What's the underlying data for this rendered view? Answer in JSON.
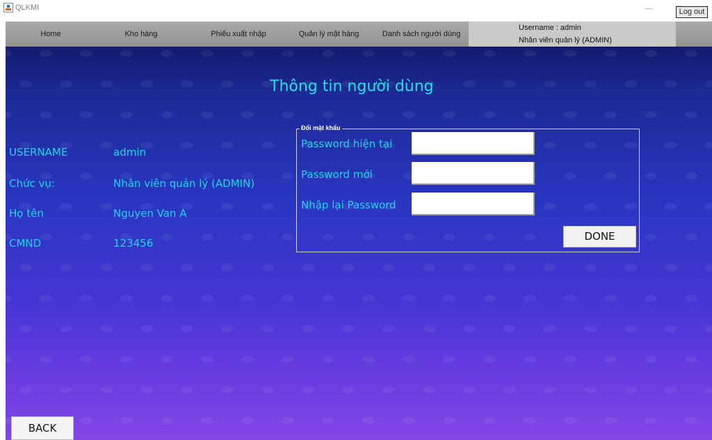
{
  "window": {
    "title": "QLKMI",
    "icon": "java-app-icon",
    "controls": {
      "minimize": "—",
      "close": "✕"
    }
  },
  "menu": {
    "home": "Home",
    "kho_hang": "Kho hàng",
    "phieu_xuat_nhap": "Phiếu xuất nhập",
    "quan_ly_mat_hang": "Quản lý mặt hàng",
    "danh_sach_nguoi_dung": "Danh sách người dùng"
  },
  "user_panel": {
    "username_line": "Username : admin",
    "role_line": "Nhân viên quản lý (ADMIN)",
    "logout_label": "Log out"
  },
  "page": {
    "title": "Thông tin người dùng"
  },
  "user_info": {
    "username_label": "USERNAME",
    "username_value": "admin",
    "chucvu_label": "Chức vụ:",
    "chucvu_value": "Nhân viên quản lý (ADMIN)",
    "hoten_label": "Họ tên",
    "hoten_value": "Nguyen Van A",
    "cmnd_label": "CMND",
    "cmnd_value": "123456"
  },
  "change_password": {
    "legend": "Đổi mật khẩu",
    "current_label": "Password hiện tại",
    "current_value": "",
    "new_label": "Password mới",
    "new_value": "",
    "confirm_label": "Nhập lại Password",
    "confirm_value": "",
    "done_label": "DONE"
  },
  "back_label": "BACK",
  "colors": {
    "accent_text": "#1fd7e4",
    "menubar": "#a0a0a0",
    "background_top": "#131b6e",
    "background_bottom": "#8248e6"
  }
}
